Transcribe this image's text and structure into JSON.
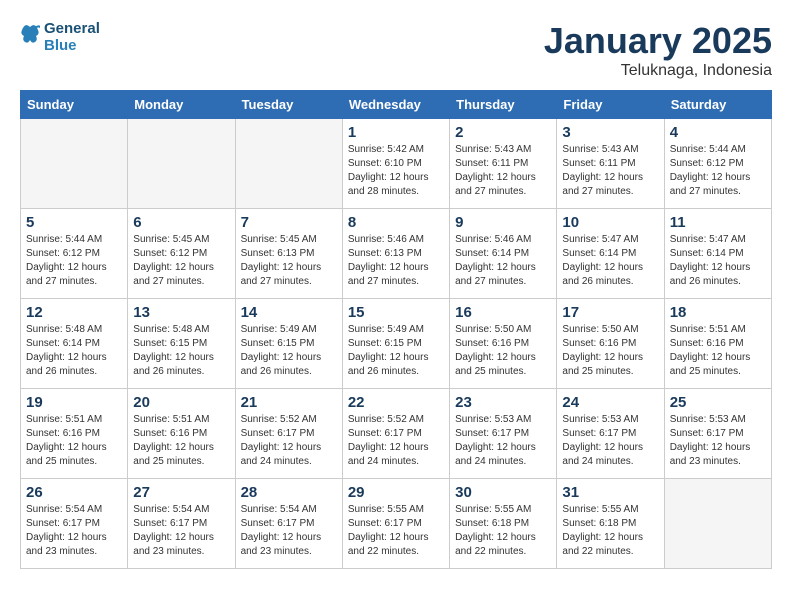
{
  "header": {
    "logo_line1": "General",
    "logo_line2": "Blue",
    "title": "January 2025",
    "subtitle": "Teluknaga, Indonesia"
  },
  "days_of_week": [
    "Sunday",
    "Monday",
    "Tuesday",
    "Wednesday",
    "Thursday",
    "Friday",
    "Saturday"
  ],
  "weeks": [
    {
      "days": [
        {
          "num": "",
          "empty": true
        },
        {
          "num": "",
          "empty": true
        },
        {
          "num": "",
          "empty": true
        },
        {
          "num": "1",
          "sunrise": "5:42 AM",
          "sunset": "6:10 PM",
          "daylight": "12 hours and 28 minutes."
        },
        {
          "num": "2",
          "sunrise": "5:43 AM",
          "sunset": "6:11 PM",
          "daylight": "12 hours and 27 minutes."
        },
        {
          "num": "3",
          "sunrise": "5:43 AM",
          "sunset": "6:11 PM",
          "daylight": "12 hours and 27 minutes."
        },
        {
          "num": "4",
          "sunrise": "5:44 AM",
          "sunset": "6:12 PM",
          "daylight": "12 hours and 27 minutes."
        }
      ]
    },
    {
      "days": [
        {
          "num": "5",
          "sunrise": "5:44 AM",
          "sunset": "6:12 PM",
          "daylight": "12 hours and 27 minutes."
        },
        {
          "num": "6",
          "sunrise": "5:45 AM",
          "sunset": "6:12 PM",
          "daylight": "12 hours and 27 minutes."
        },
        {
          "num": "7",
          "sunrise": "5:45 AM",
          "sunset": "6:13 PM",
          "daylight": "12 hours and 27 minutes."
        },
        {
          "num": "8",
          "sunrise": "5:46 AM",
          "sunset": "6:13 PM",
          "daylight": "12 hours and 27 minutes."
        },
        {
          "num": "9",
          "sunrise": "5:46 AM",
          "sunset": "6:14 PM",
          "daylight": "12 hours and 27 minutes."
        },
        {
          "num": "10",
          "sunrise": "5:47 AM",
          "sunset": "6:14 PM",
          "daylight": "12 hours and 26 minutes."
        },
        {
          "num": "11",
          "sunrise": "5:47 AM",
          "sunset": "6:14 PM",
          "daylight": "12 hours and 26 minutes."
        }
      ]
    },
    {
      "days": [
        {
          "num": "12",
          "sunrise": "5:48 AM",
          "sunset": "6:14 PM",
          "daylight": "12 hours and 26 minutes."
        },
        {
          "num": "13",
          "sunrise": "5:48 AM",
          "sunset": "6:15 PM",
          "daylight": "12 hours and 26 minutes."
        },
        {
          "num": "14",
          "sunrise": "5:49 AM",
          "sunset": "6:15 PM",
          "daylight": "12 hours and 26 minutes."
        },
        {
          "num": "15",
          "sunrise": "5:49 AM",
          "sunset": "6:15 PM",
          "daylight": "12 hours and 26 minutes."
        },
        {
          "num": "16",
          "sunrise": "5:50 AM",
          "sunset": "6:16 PM",
          "daylight": "12 hours and 25 minutes."
        },
        {
          "num": "17",
          "sunrise": "5:50 AM",
          "sunset": "6:16 PM",
          "daylight": "12 hours and 25 minutes."
        },
        {
          "num": "18",
          "sunrise": "5:51 AM",
          "sunset": "6:16 PM",
          "daylight": "12 hours and 25 minutes."
        }
      ]
    },
    {
      "days": [
        {
          "num": "19",
          "sunrise": "5:51 AM",
          "sunset": "6:16 PM",
          "daylight": "12 hours and 25 minutes."
        },
        {
          "num": "20",
          "sunrise": "5:51 AM",
          "sunset": "6:16 PM",
          "daylight": "12 hours and 25 minutes."
        },
        {
          "num": "21",
          "sunrise": "5:52 AM",
          "sunset": "6:17 PM",
          "daylight": "12 hours and 24 minutes."
        },
        {
          "num": "22",
          "sunrise": "5:52 AM",
          "sunset": "6:17 PM",
          "daylight": "12 hours and 24 minutes."
        },
        {
          "num": "23",
          "sunrise": "5:53 AM",
          "sunset": "6:17 PM",
          "daylight": "12 hours and 24 minutes."
        },
        {
          "num": "24",
          "sunrise": "5:53 AM",
          "sunset": "6:17 PM",
          "daylight": "12 hours and 24 minutes."
        },
        {
          "num": "25",
          "sunrise": "5:53 AM",
          "sunset": "6:17 PM",
          "daylight": "12 hours and 23 minutes."
        }
      ]
    },
    {
      "days": [
        {
          "num": "26",
          "sunrise": "5:54 AM",
          "sunset": "6:17 PM",
          "daylight": "12 hours and 23 minutes."
        },
        {
          "num": "27",
          "sunrise": "5:54 AM",
          "sunset": "6:17 PM",
          "daylight": "12 hours and 23 minutes."
        },
        {
          "num": "28",
          "sunrise": "5:54 AM",
          "sunset": "6:17 PM",
          "daylight": "12 hours and 23 minutes."
        },
        {
          "num": "29",
          "sunrise": "5:55 AM",
          "sunset": "6:17 PM",
          "daylight": "12 hours and 22 minutes."
        },
        {
          "num": "30",
          "sunrise": "5:55 AM",
          "sunset": "6:18 PM",
          "daylight": "12 hours and 22 minutes."
        },
        {
          "num": "31",
          "sunrise": "5:55 AM",
          "sunset": "6:18 PM",
          "daylight": "12 hours and 22 minutes."
        },
        {
          "num": "",
          "empty": true
        }
      ]
    }
  ]
}
